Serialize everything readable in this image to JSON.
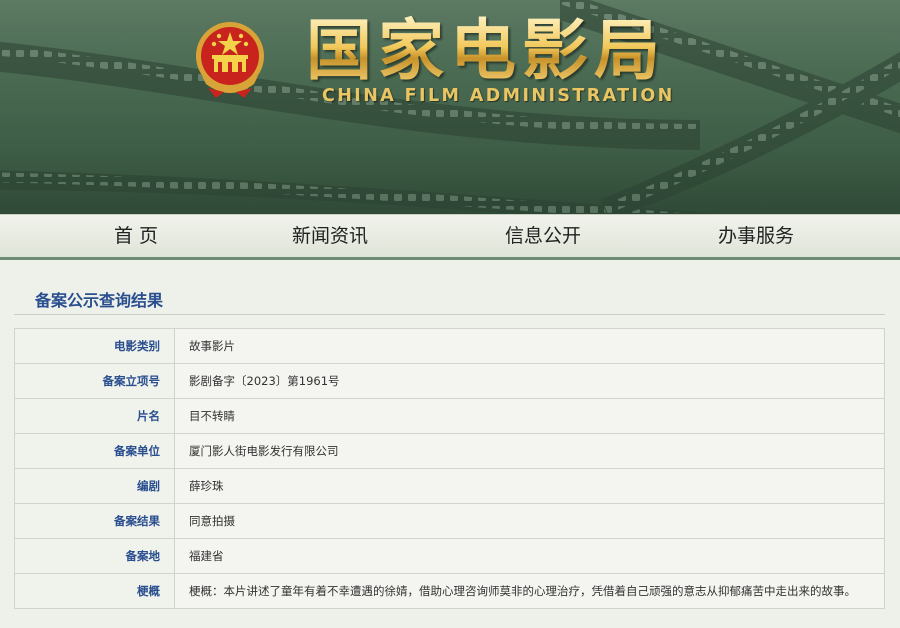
{
  "header": {
    "title_cn": "国家电影局",
    "title_en": "CHINA FILM ADMINISTRATION",
    "emblem_icon": "national-emblem-icon"
  },
  "nav": {
    "items": [
      {
        "label": "首 页"
      },
      {
        "label": "新闻资讯"
      },
      {
        "label": "信息公开"
      },
      {
        "label": "办事服务"
      }
    ]
  },
  "main": {
    "section_title": "备案公示查询结果",
    "rows": [
      {
        "label": "电影类别",
        "value": "故事影片"
      },
      {
        "label": "备案立项号",
        "value": "影剧备字〔2023〕第1961号"
      },
      {
        "label": "片名",
        "value": "目不转睛"
      },
      {
        "label": "备案单位",
        "value": "厦门影人街电影发行有限公司"
      },
      {
        "label": "编剧",
        "value": "薛珍珠"
      },
      {
        "label": "备案结果",
        "value": "同意拍摄"
      },
      {
        "label": "备案地",
        "value": "福建省"
      },
      {
        "label": "梗概",
        "value": "梗概：本片讲述了童年有着不幸遭遇的徐婧，借助心理咨询师莫非的心理治疗，凭借着自己顽强的意志从抑郁痛苦中走出来的故事。"
      }
    ]
  },
  "colors": {
    "banner_green": "#3e5d46",
    "gold": "#f1c85a",
    "label_blue": "#2a4f8f"
  }
}
